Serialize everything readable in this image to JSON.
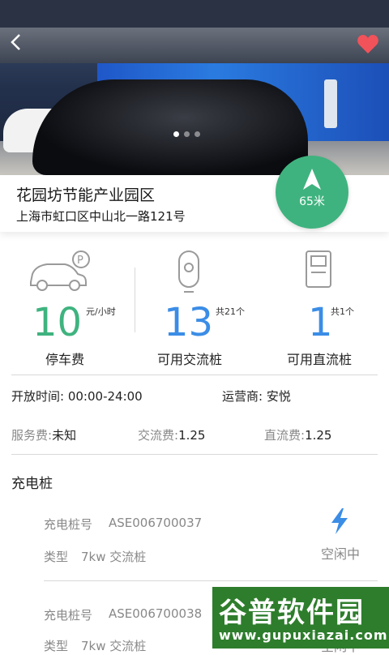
{
  "station": {
    "name": "花园坊节能产业园区",
    "address": "上海市虹口区中山北一路121号",
    "distance": "65米"
  },
  "stats": [
    {
      "value": "10",
      "unit": "元/小时",
      "label": "停车费",
      "color": "#3fb37f"
    },
    {
      "value": "13",
      "unit": "共21个",
      "label": "可用交流桩",
      "color": "#3b8de6"
    },
    {
      "value": "1",
      "unit": "共1个",
      "label": "可用直流桩",
      "color": "#3b8de6"
    }
  ],
  "details": {
    "open_label": "开放时间:",
    "open_value": "00:00-24:00",
    "operator_label": "运营商:",
    "operator_value": "安悦",
    "service_label": "服务费:",
    "service_value": "未知",
    "ac_label": "交流费:",
    "ac_value": "1.25",
    "dc_label": "直流费:",
    "dc_value": "1.25"
  },
  "piles_title": "充电桩",
  "piles": [
    {
      "no_label": "充电桩号",
      "no": "ASE006700037",
      "type_label": "类型",
      "type": "7kw 交流桩",
      "status": "空闲中"
    },
    {
      "no_label": "充电桩号",
      "no": "ASE006700038",
      "type_label": "类型",
      "type": "7kw 交流桩",
      "status": "空闲中"
    }
  ],
  "watermark": {
    "line1": "谷普软件园",
    "line2": "www.gupuxiazai.com"
  },
  "colors": {
    "accent_green": "#3fb37f",
    "accent_blue": "#3b8de6",
    "heart": "#f2525a",
    "bolt": "#3b8de6"
  },
  "icons": {
    "back": "chevron-left-icon",
    "favorite": "heart-icon",
    "navigate": "navigation-arrow-icon",
    "parking": "car-parking-icon",
    "ac": "ac-charger-icon",
    "dc": "dc-charger-icon",
    "bolt": "lightning-icon"
  },
  "carousel": {
    "count": 3,
    "active": 1
  }
}
